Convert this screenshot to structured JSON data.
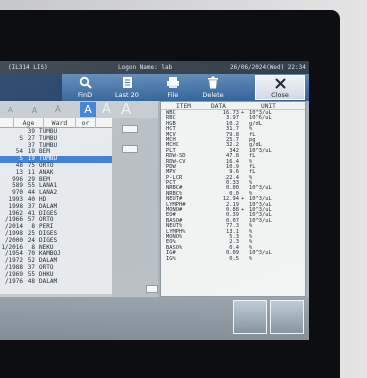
{
  "window": {
    "title": "(IL314 LIS)",
    "logon": "Logon Name: lab",
    "datetime": "26/06/2024(Wed) 22:34"
  },
  "toolbar": {
    "find_label": "FinD",
    "last20_label": "Last 20",
    "file_label": "File",
    "delete_label": "Delete",
    "close_label": "Close"
  },
  "icons": {
    "find": "search-icon",
    "last20": "list-icon",
    "file": "file-icon",
    "delete": "delete-icon",
    "close": "close-icon"
  },
  "colors": {
    "titlebar": "#2e3945",
    "toolbar": "#3f6fa6",
    "toolbar_dark": "#1f3c63",
    "selection": "#3d7fd6",
    "result_panel": "#f1f3f3",
    "list_panel": "#e6eaec",
    "pane": "#c4cbd1",
    "bezel": "#0d0e11"
  },
  "font_size_buttons": {
    "labels": [
      "A",
      "A",
      "A",
      "A",
      "A",
      "A"
    ],
    "selected": 3
  },
  "patients": {
    "headers": {
      "age": "Age",
      "ward": "Ward",
      "other": "or"
    },
    "selected_row": 4,
    "rows": [
      {
        "id": "",
        "age": "39",
        "ward": "TUMBU"
      },
      {
        "id": "S",
        "age": "27",
        "ward": "TUMBU"
      },
      {
        "id": "",
        "age": "37",
        "ward": "TUMBU"
      },
      {
        "id": "54",
        "age": "19",
        "ward": "BEM"
      },
      {
        "id": "5",
        "age": "19",
        "ward": "TUMBU"
      },
      {
        "id": "48",
        "age": "75",
        "ward": "ORTO"
      },
      {
        "id": "13",
        "age": "11",
        "ward": "ANAK"
      },
      {
        "id": "996",
        "age": "29",
        "ward": "BEM"
      },
      {
        "id": "589",
        "age": "55",
        "ward": "LANA1"
      },
      {
        "id": "970",
        "age": "44",
        "ward": "LANA2"
      },
      {
        "id": "1993",
        "age": "40",
        "ward": "HD"
      },
      {
        "id": "1998",
        "age": "37",
        "ward": "DALAM"
      },
      {
        "id": "1962",
        "age": "41",
        "ward": "DIGES"
      },
      {
        "id": "/1966",
        "age": "57",
        "ward": "ORTO"
      },
      {
        "id": "/2014",
        "age": "8",
        "ward": "PERI"
      },
      {
        "id": "/1998",
        "age": "25",
        "ward": "DIGES"
      },
      {
        "id": "/2000",
        "age": "24",
        "ward": "DIGES"
      },
      {
        "id": "1/2016",
        "age": "8",
        "ward": "NEKU"
      },
      {
        "id": "/1954",
        "age": "70",
        "ward": "KAMBOJ"
      },
      {
        "id": "/1972",
        "age": "52",
        "ward": "DALAM"
      },
      {
        "id": "/1988",
        "age": "37",
        "ward": "ORTO"
      },
      {
        "id": "/1969",
        "age": "55",
        "ward": "DHKU"
      },
      {
        "id": "/1976",
        "age": "48",
        "ward": "DALAM"
      }
    ]
  },
  "results": {
    "headers": {
      "item": "ITEM",
      "data": "DATA",
      "unit": "UNIT"
    },
    "rows": [
      {
        "item": "WBC",
        "data": "16.73",
        "flag": "+",
        "unit": "10^3/uL"
      },
      {
        "item": "RBC",
        "data": "3.97",
        "flag": "",
        "unit": "10^6/uL"
      },
      {
        "item": "HGB",
        "data": "10.2",
        "flag": "",
        "unit": "g/dL"
      },
      {
        "item": "HCT",
        "data": "31.7",
        "flag": "",
        "unit": "%"
      },
      {
        "item": "MCV",
        "data": "79.8",
        "flag": "",
        "unit": "fL"
      },
      {
        "item": "MCH",
        "data": "25.7",
        "flag": "",
        "unit": "pg"
      },
      {
        "item": "MCHC",
        "data": "32.2",
        "flag": "",
        "unit": "g/dL"
      },
      {
        "item": "PLT",
        "data": "342",
        "flag": "",
        "unit": "10^3/uL"
      },
      {
        "item": "RDW-SD",
        "data": "47.8",
        "flag": "",
        "unit": "fL"
      },
      {
        "item": "RDW-CV",
        "data": "16.4",
        "flag": "",
        "unit": "%"
      },
      {
        "item": "PDW",
        "data": "10.9",
        "flag": "",
        "unit": "fL"
      },
      {
        "item": "MPV",
        "data": "9.6",
        "flag": "",
        "unit": "fL"
      },
      {
        "item": "P-LCR",
        "data": "22.4",
        "flag": "",
        "unit": "%"
      },
      {
        "item": "PCT",
        "data": "0.33",
        "flag": "",
        "unit": "%"
      },
      {
        "item": "NRBC#",
        "data": "0.00",
        "flag": "",
        "unit": "10^3/uL"
      },
      {
        "item": "NRBC%",
        "data": "0.0",
        "flag": "",
        "unit": "%"
      },
      {
        "item": "NEUT#",
        "data": "12.94",
        "flag": "+",
        "unit": "10^3/uL"
      },
      {
        "item": "LYMPH#",
        "data": "2.19",
        "flag": "",
        "unit": "10^3/uL"
      },
      {
        "item": "MONO#",
        "data": "0.88",
        "flag": "+",
        "unit": "10^3/uL"
      },
      {
        "item": "EO#",
        "data": "0.39",
        "flag": "",
        "unit": "10^3/uL"
      },
      {
        "item": "BASO#",
        "data": "0.07",
        "flag": "",
        "unit": "10^3/uL"
      },
      {
        "item": "NEUT%",
        "data": "77.3",
        "flag": "",
        "unit": "%"
      },
      {
        "item": "LYMPH%",
        "data": "13.1",
        "flag": "",
        "unit": "%"
      },
      {
        "item": "MONO%",
        "data": "5.3",
        "flag": "",
        "unit": "%"
      },
      {
        "item": "EO%",
        "data": "2.3",
        "flag": "",
        "unit": "%"
      },
      {
        "item": "BASO%",
        "data": "0.4",
        "flag": "",
        "unit": "%"
      },
      {
        "item": "IG#",
        "data": "0.09",
        "flag": "",
        "unit": "10^3/uL"
      },
      {
        "item": "IG%",
        "data": "0.5",
        "flag": "",
        "unit": "%"
      }
    ]
  }
}
